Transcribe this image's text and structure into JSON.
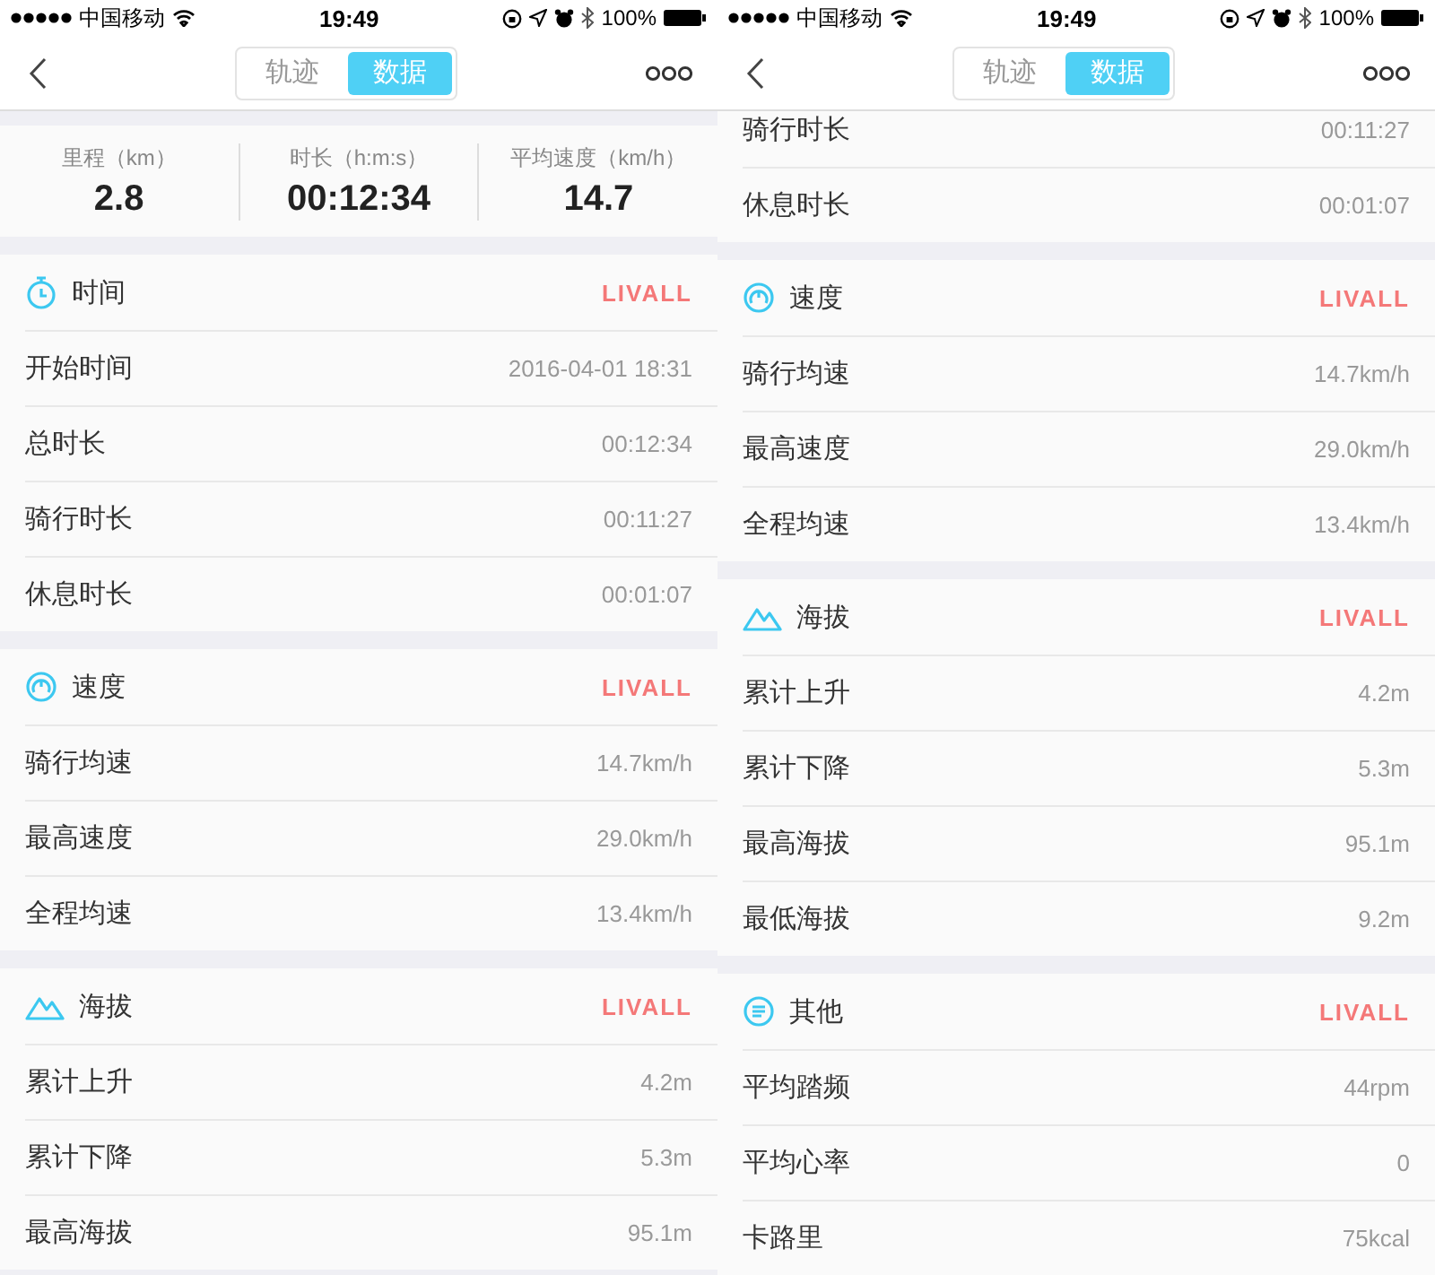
{
  "panels": [
    {
      "status_bar": {
        "carrier": "中国移动",
        "time": "19:49",
        "battery": "100%"
      },
      "nav": {
        "tabs": [
          {
            "label": "轨迹",
            "selected": false
          },
          {
            "label": "数据",
            "selected": true
          }
        ]
      },
      "summary": [
        {
          "label": "里程（km）",
          "value": "2.8"
        },
        {
          "label": "时长（h:m:s）",
          "value": "00:12:34"
        },
        {
          "label": "平均速度（km/h）",
          "value": "14.7"
        }
      ],
      "sections": [
        {
          "kind": "stopwatch",
          "title": "时间",
          "brand": "LIVALL",
          "rows": [
            {
              "label": "开始时间",
              "value": "2016-04-01 18:31"
            },
            {
              "label": "总时长",
              "value": "00:12:34"
            },
            {
              "label": "骑行时长",
              "value": "00:11:27"
            },
            {
              "label": "休息时长",
              "value": "00:01:07"
            }
          ]
        },
        {
          "kind": "speedometer",
          "title": "速度",
          "brand": "LIVALL",
          "rows": [
            {
              "label": "骑行均速",
              "value": "14.7km/h"
            },
            {
              "label": "最高速度",
              "value": "29.0km/h"
            },
            {
              "label": "全程均速",
              "value": "13.4km/h"
            }
          ]
        },
        {
          "kind": "mountain",
          "title": "海拔",
          "brand": "LIVALL",
          "rows": [
            {
              "label": "累计上升",
              "value": "4.2m"
            },
            {
              "label": "累计下降",
              "value": "5.3m"
            },
            {
              "label": "最高海拔",
              "value": "95.1m"
            }
          ]
        }
      ]
    },
    {
      "status_bar": {
        "carrier": "中国移动",
        "time": "19:49",
        "battery": "100%"
      },
      "nav": {
        "tabs": [
          {
            "label": "轨迹",
            "selected": false
          },
          {
            "label": "数据",
            "selected": true
          }
        ]
      },
      "sections": [
        {
          "rows": [
            {
              "label": "骑行时长",
              "value": "00:11:27"
            },
            {
              "label": "休息时长",
              "value": "00:01:07"
            }
          ]
        },
        {
          "kind": "speedometer",
          "title": "速度",
          "brand": "LIVALL",
          "rows": [
            {
              "label": "骑行均速",
              "value": "14.7km/h"
            },
            {
              "label": "最高速度",
              "value": "29.0km/h"
            },
            {
              "label": "全程均速",
              "value": "13.4km/h"
            }
          ]
        },
        {
          "kind": "mountain",
          "title": "海拔",
          "brand": "LIVALL",
          "rows": [
            {
              "label": "累计上升",
              "value": "4.2m"
            },
            {
              "label": "累计下降",
              "value": "5.3m"
            },
            {
              "label": "最高海拔",
              "value": "95.1m"
            },
            {
              "label": "最低海拔",
              "value": "9.2m"
            }
          ]
        },
        {
          "kind": "list",
          "title": "其他",
          "brand": "LIVALL",
          "rows": [
            {
              "label": "平均踏频",
              "value": "44rpm"
            },
            {
              "label": "平均心率",
              "value": "0"
            },
            {
              "label": "卡路里",
              "value": "75kcal"
            }
          ]
        }
      ]
    }
  ]
}
